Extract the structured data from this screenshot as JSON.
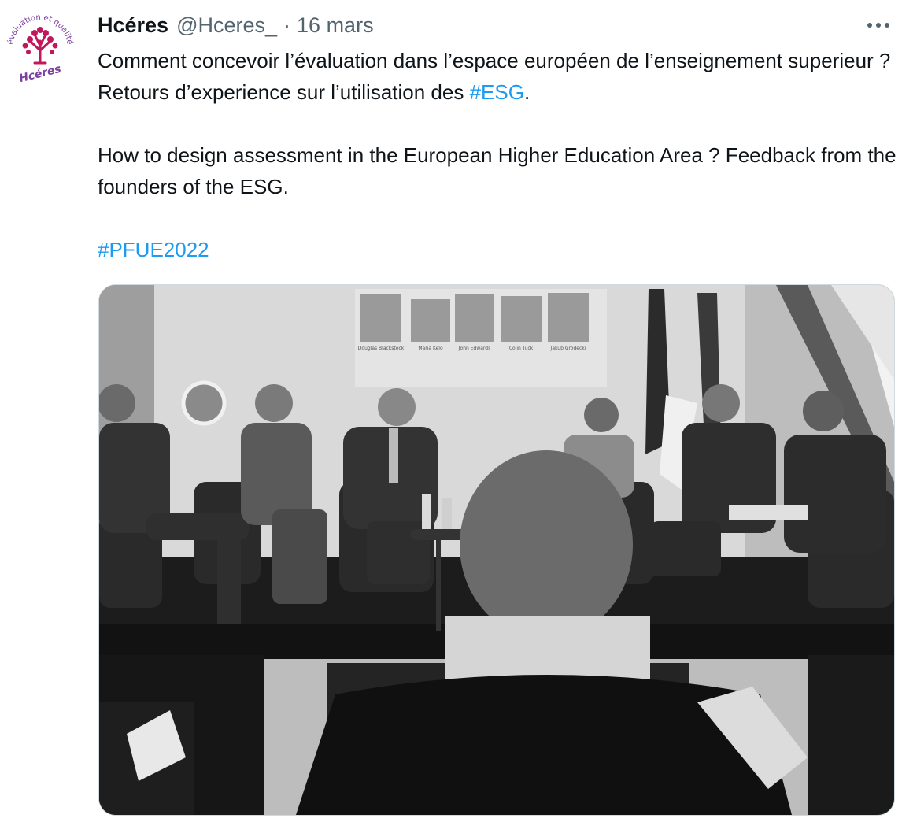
{
  "tweet": {
    "avatar": {
      "arc_text": "évaluation et qualité",
      "brand": "Hcéres",
      "accent_color": "#c2185b",
      "brand_color": "#7b3fa0"
    },
    "author": {
      "display_name": "Hcéres",
      "handle": "@Hceres_",
      "separator": "·",
      "date": "16 mars"
    },
    "more_icon": "more-horizontal-icon",
    "text": {
      "line1_before": "Comment concevoir l’évaluation dans l’espace européen de l’enseignement superieur ? Retours d’experience sur l’utilisation des ",
      "hashtag_esg": "#ESG",
      "line1_after": ".",
      "line2": "How to design assessment in the European Higher Education Area ? Feedback from the founders of the ESG.",
      "hashtag_pfue": "#PFUE2022"
    },
    "media": {
      "slide_names": [
        "Douglas Blackstock",
        "Maria Kelo",
        "John Edwards",
        "Colin Tück",
        "Jakub Grodecki"
      ],
      "link_color": "#1d9bf0",
      "border_color": "#cfd9de"
    }
  }
}
